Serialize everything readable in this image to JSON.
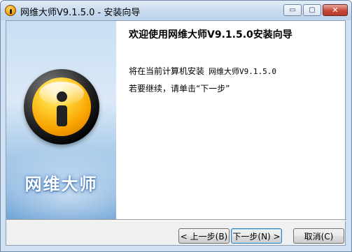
{
  "window": {
    "title": "网维大师V9.1.5.0 - 安装向导",
    "icon": "app-info-icon",
    "controls": {
      "minimize": "▭",
      "maximize": "▢",
      "close": "✕"
    }
  },
  "banner": {
    "logo_icon": "info-i-icon",
    "product_name": "网维大师"
  },
  "content": {
    "heading": "欢迎使用网维大师V9.1.5.0安装向导",
    "install_prefix": "将在当前计算机安装",
    "install_product": "网维大师V9.1.5.0",
    "continue_hint": "若要继续，请单击“下一步”"
  },
  "buttons": {
    "back": "< 上一步(B)",
    "next": "下一步(N) >",
    "cancel": "取消(C)"
  },
  "colors": {
    "accent": "#f7a300",
    "banner_blue": "#5f9ad3"
  }
}
